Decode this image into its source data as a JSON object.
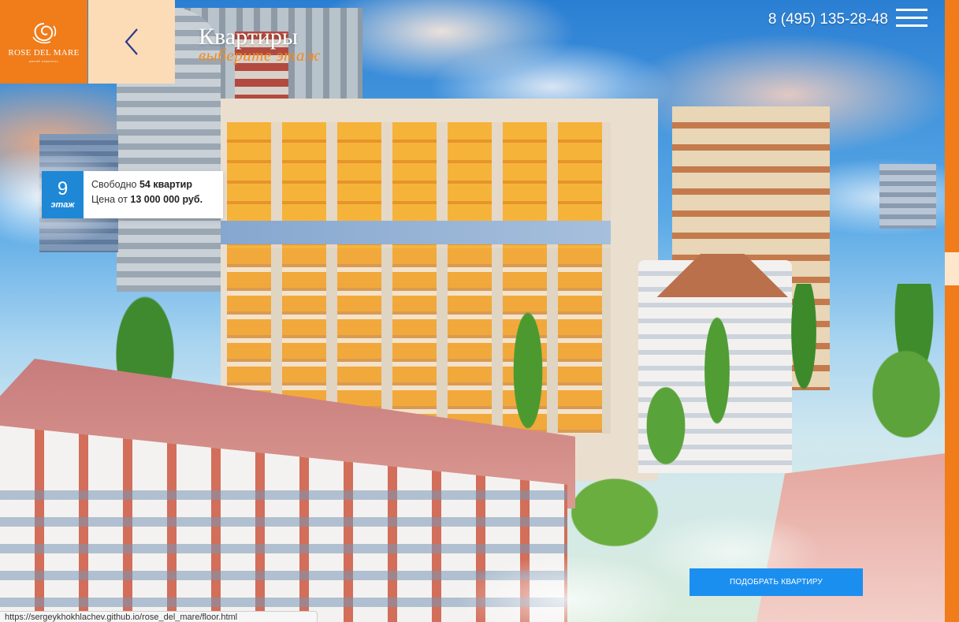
{
  "brand": {
    "name": "ROSE DEL MARE",
    "tagline": "жилой комплекс",
    "color": "#f07c1a"
  },
  "header": {
    "title": "Квартиры",
    "subtitle": "выберите этаж",
    "phone": "8 (495) 135-28-48",
    "back_icon": "chevron-left-icon",
    "menu_icon": "hamburger-menu-icon"
  },
  "floor_card": {
    "floor_number": "9",
    "floor_word": "этаж",
    "available_prefix": "Свободно",
    "available_value": "54 квартир",
    "price_prefix": "Цена от",
    "price_value": "13 000 000 руб.",
    "badge_color": "#1e88d6"
  },
  "cta": {
    "label": "ПОДОБРАТЬ КВАРТИРУ",
    "color": "#1b8ff0"
  },
  "status_bar": {
    "url": "https://sergeykhokhlachev.github.io/rose_del_mare/floor.html"
  }
}
